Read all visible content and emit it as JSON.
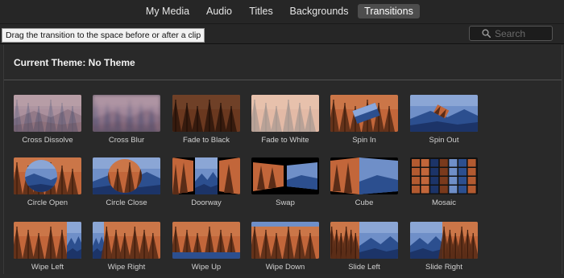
{
  "tabs": [
    {
      "label": "My Media",
      "active": false
    },
    {
      "label": "Audio",
      "active": false
    },
    {
      "label": "Titles",
      "active": false
    },
    {
      "label": "Backgrounds",
      "active": false
    },
    {
      "label": "Transitions",
      "active": true
    }
  ],
  "tooltip": "Drag the transition to the space before or after a clip",
  "search": {
    "placeholder": "Search",
    "value": ""
  },
  "theme_title": "Current Theme: No Theme",
  "transitions": [
    {
      "label": "Cross Dissolve",
      "style": "cross-dissolve"
    },
    {
      "label": "Cross Blur",
      "style": "cross-blur"
    },
    {
      "label": "Fade to Black",
      "style": "fade-black"
    },
    {
      "label": "Fade to White",
      "style": "fade-white"
    },
    {
      "label": "Spin In",
      "style": "spin-in"
    },
    {
      "label": "Spin Out",
      "style": "spin-out"
    },
    {
      "label": "Circle Open",
      "style": "circle-open"
    },
    {
      "label": "Circle Close",
      "style": "circle-close"
    },
    {
      "label": "Doorway",
      "style": "doorway"
    },
    {
      "label": "Swap",
      "style": "swap"
    },
    {
      "label": "Cube",
      "style": "cube"
    },
    {
      "label": "Mosaic",
      "style": "mosaic"
    },
    {
      "label": "Wipe Left",
      "style": "wipe-left"
    },
    {
      "label": "Wipe Right",
      "style": "wipe-right"
    },
    {
      "label": "Wipe Up",
      "style": "wipe-up"
    },
    {
      "label": "Wipe Down",
      "style": "wipe-down"
    },
    {
      "label": "Slide Left",
      "style": "slide-left"
    },
    {
      "label": "Slide Right",
      "style": "slide-right"
    }
  ],
  "colors": {
    "forest_bg": "#c2663a",
    "forest_tree": "#5a2c17",
    "mountain_sky": "#6f8fc8",
    "mountain_back": "#2c4f8f",
    "mountain_front": "#1c3468"
  }
}
